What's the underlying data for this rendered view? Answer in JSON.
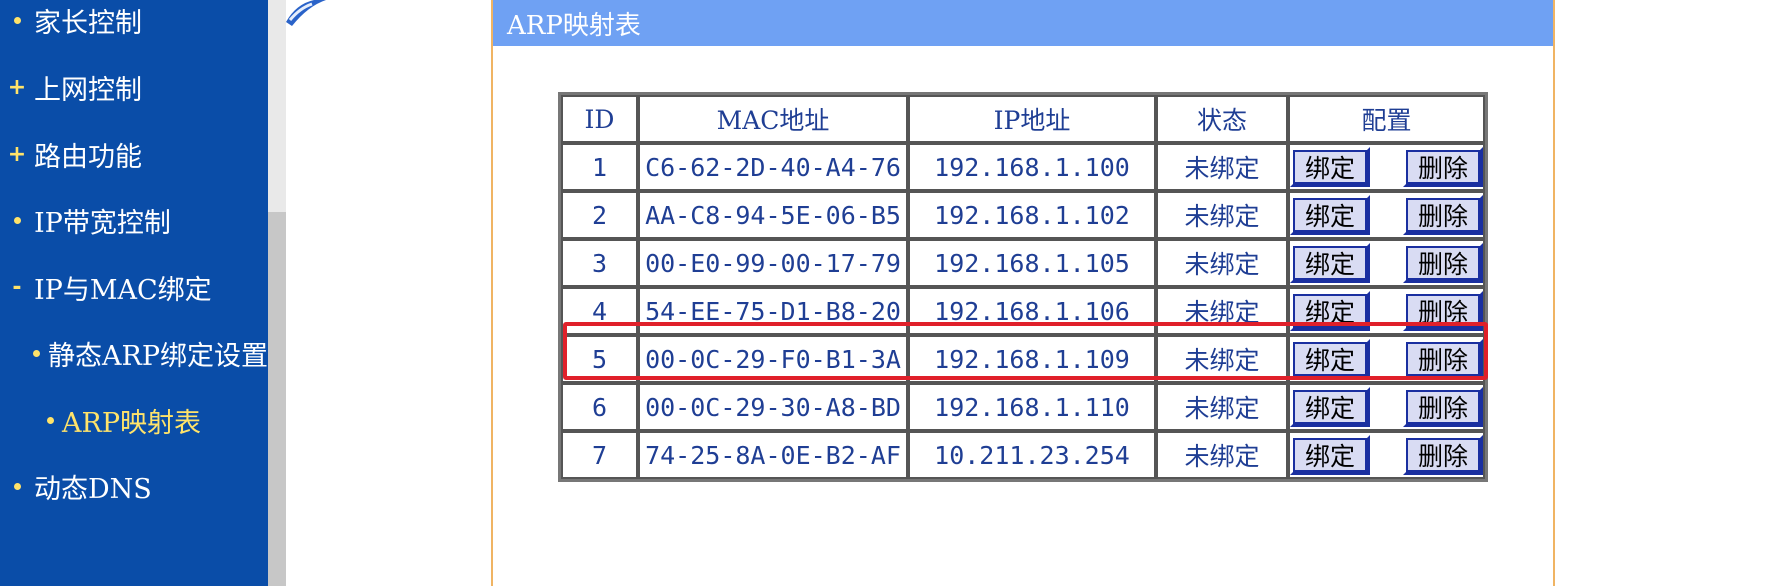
{
  "sidebar": {
    "items": [
      {
        "label": "家长控制",
        "bullet": "dot"
      },
      {
        "label": "上网控制",
        "bullet": "+"
      },
      {
        "label": "路由功能",
        "bullet": "+"
      },
      {
        "label": "IP带宽控制",
        "bullet": "dot"
      },
      {
        "label": "IP与MAC绑定",
        "bullet": "-"
      },
      {
        "label": "静态ARP绑定设置",
        "bullet": "dot",
        "sub": true
      },
      {
        "label": "ARP映射表",
        "bullet": "dot",
        "sub": true,
        "active": true
      },
      {
        "label": "动态DNS",
        "bullet": "dot"
      }
    ]
  },
  "panel": {
    "title": "ARP映射表"
  },
  "table": {
    "headers": {
      "id": "ID",
      "mac": "MAC地址",
      "ip": "IP地址",
      "status": "状态",
      "config": "配置"
    },
    "rows": [
      {
        "id": "1",
        "mac": "C6-62-2D-40-A4-76",
        "ip": "192.168.1.100",
        "status": "未绑定",
        "bind": "绑定",
        "del": "删除"
      },
      {
        "id": "2",
        "mac": "AA-C8-94-5E-06-B5",
        "ip": "192.168.1.102",
        "status": "未绑定",
        "bind": "绑定",
        "del": "删除"
      },
      {
        "id": "3",
        "mac": "00-E0-99-00-17-79",
        "ip": "192.168.1.105",
        "status": "未绑定",
        "bind": "绑定",
        "del": "删除"
      },
      {
        "id": "4",
        "mac": "54-EE-75-D1-B8-20",
        "ip": "192.168.1.106",
        "status": "未绑定",
        "bind": "绑定",
        "del": "删除"
      },
      {
        "id": "5",
        "mac": "00-0C-29-F0-B1-3A",
        "ip": "192.168.1.109",
        "status": "未绑定",
        "bind": "绑定",
        "del": "删除"
      },
      {
        "id": "6",
        "mac": "00-0C-29-30-A8-BD",
        "ip": "192.168.1.110",
        "status": "未绑定",
        "bind": "绑定",
        "del": "删除"
      },
      {
        "id": "7",
        "mac": "74-25-8A-0E-B2-AF",
        "ip": "10.211.23.254",
        "status": "未绑定",
        "bind": "绑定",
        "del": "删除"
      }
    ],
    "highlighted_row": 5
  },
  "colors": {
    "sidebar_bg": "#0a4da8",
    "header_bg": "#6fa1f3",
    "highlight": "#e0202a",
    "table_text": "#1f3e94"
  }
}
